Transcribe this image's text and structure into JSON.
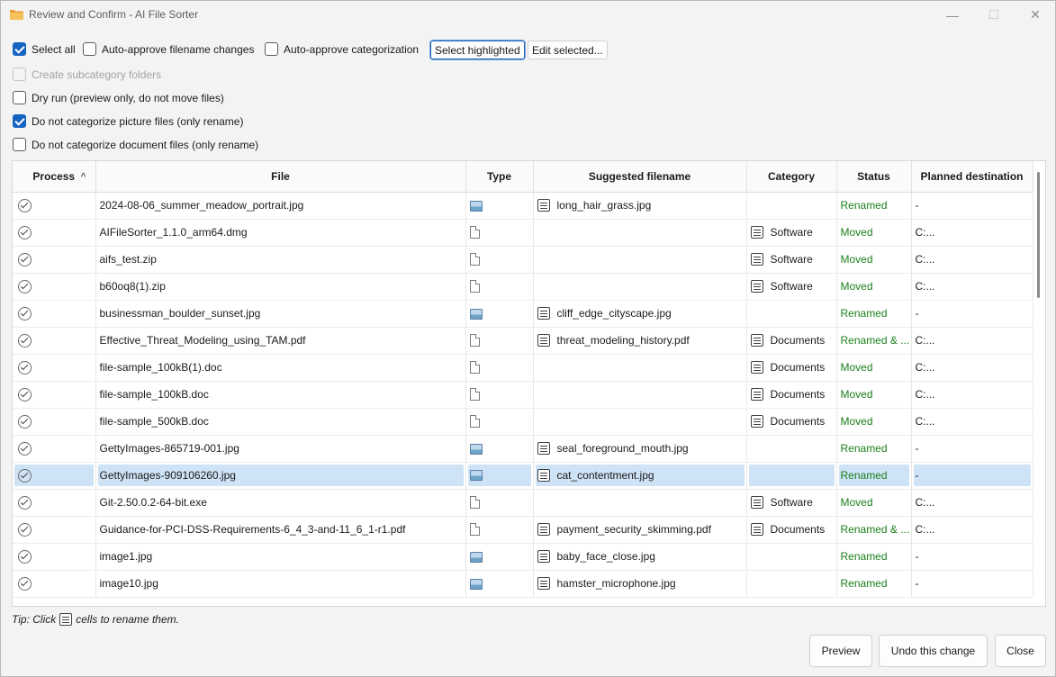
{
  "window": {
    "title": "Review and Confirm - AI File Sorter",
    "minimize_glyph": "—",
    "maximize_glyph": "☐",
    "close_glyph": "✕"
  },
  "options": {
    "select_all": "Select all",
    "auto_approve_filenames": "Auto-approve filename changes",
    "auto_approve_categorization": "Auto-approve categorization",
    "select_highlighted": "Select highlighted",
    "edit_selected": "Edit selected...",
    "create_subcategory": "Create subcategory folders",
    "dry_run": "Dry run (preview only, do not move files)",
    "no_categorize_pictures": "Do not categorize picture files (only rename)",
    "no_categorize_documents": "Do not categorize document files (only rename)"
  },
  "table": {
    "headers": [
      "Process",
      "File",
      "Type",
      "Suggested filename",
      "Category",
      "Status",
      "Planned destination"
    ],
    "sort_glyph": "^",
    "rows": [
      {
        "file": "2024-08-06_summer_meadow_portrait.jpg",
        "type": "image",
        "suggested": "long_hair_grass.jpg",
        "category": "",
        "status": "Renamed",
        "dest": "-"
      },
      {
        "file": "AIFileSorter_1.1.0_arm64.dmg",
        "type": "file",
        "suggested": "",
        "category": "Software",
        "status": "Moved",
        "dest": "C:..."
      },
      {
        "file": "aifs_test.zip",
        "type": "file",
        "suggested": "",
        "category": "Software",
        "status": "Moved",
        "dest": "C:..."
      },
      {
        "file": "b60oq8(1).zip",
        "type": "file",
        "suggested": "",
        "category": "Software",
        "status": "Moved",
        "dest": "C:..."
      },
      {
        "file": "businessman_boulder_sunset.jpg",
        "type": "image",
        "suggested": "cliff_edge_cityscape.jpg",
        "category": "",
        "status": "Renamed",
        "dest": "-"
      },
      {
        "file": "Effective_Threat_Modeling_using_TAM.pdf",
        "type": "file",
        "suggested": "threat_modeling_history.pdf",
        "category": "Documents",
        "status": "Renamed & ...",
        "dest": "C:..."
      },
      {
        "file": "file-sample_100kB(1).doc",
        "type": "file",
        "suggested": "",
        "category": "Documents",
        "status": "Moved",
        "dest": "C:..."
      },
      {
        "file": "file-sample_100kB.doc",
        "type": "file",
        "suggested": "",
        "category": "Documents",
        "status": "Moved",
        "dest": "C:..."
      },
      {
        "file": "file-sample_500kB.doc",
        "type": "file",
        "suggested": "",
        "category": "Documents",
        "status": "Moved",
        "dest": "C:..."
      },
      {
        "file": "GettyImages-865719-001.jpg",
        "type": "image",
        "suggested": "seal_foreground_mouth.jpg",
        "category": "",
        "status": "Renamed",
        "dest": "-"
      },
      {
        "file": "GettyImages-909106260.jpg",
        "type": "image",
        "suggested": "cat_contentment.jpg",
        "category": "",
        "status": "Renamed",
        "dest": "-",
        "selected": true
      },
      {
        "file": "Git-2.50.0.2-64-bit.exe",
        "type": "file",
        "suggested": "",
        "category": "Software",
        "status": "Moved",
        "dest": "C:..."
      },
      {
        "file": "Guidance-for-PCI-DSS-Requirements-6_4_3-and-11_6_1-r1.pdf",
        "type": "file",
        "suggested": "payment_security_skimming.pdf",
        "category": "Documents",
        "status": "Renamed & ...",
        "dest": "C:..."
      },
      {
        "file": "image1.jpg",
        "type": "image",
        "suggested": "baby_face_close.jpg",
        "category": "",
        "status": "Renamed",
        "dest": "-"
      },
      {
        "file": "image10.jpg",
        "type": "image",
        "suggested": "hamster_microphone.jpg",
        "category": "",
        "status": "Renamed",
        "dest": "-"
      }
    ]
  },
  "tip": {
    "before": "Tip: Click",
    "after": "cells to rename them."
  },
  "buttons": {
    "preview": "Preview",
    "undo": "Undo this change",
    "close": "Close"
  },
  "colors": {
    "accent": "#1764c0",
    "status_green": "#1a7f1a",
    "selection": "#cfe3f6"
  }
}
